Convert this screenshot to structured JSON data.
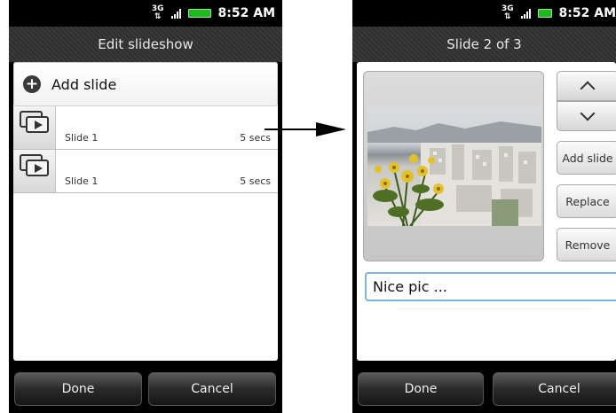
{
  "left_screen": {
    "status": {
      "network": "3G",
      "time": "8:52 AM"
    },
    "title": "Edit slideshow",
    "add_slide_label": "Add slide",
    "slides": [
      {
        "name": "Slide 1",
        "duration": "5 secs"
      },
      {
        "name": "Slide 1",
        "duration": "5 secs"
      }
    ],
    "buttons": {
      "done": "Done",
      "cancel": "Cancel"
    }
  },
  "right_screen": {
    "status": {
      "network": "3G",
      "time": "8:52 AM"
    },
    "title": "Slide 2 of 3",
    "side_buttons": {
      "add_slide": "Add slide",
      "replace": "Replace",
      "remove": "Remove"
    },
    "caption_value": "Nice pic ...",
    "buttons": {
      "done": "Done",
      "cancel": "Cancel"
    }
  },
  "colors": {
    "battery": "#1fb81f",
    "focus_border": "#7fb3d9"
  },
  "icons": [
    "plus-icon",
    "slides-icon",
    "chevron-up-icon",
    "chevron-down-icon",
    "arrow-right-icon"
  ]
}
